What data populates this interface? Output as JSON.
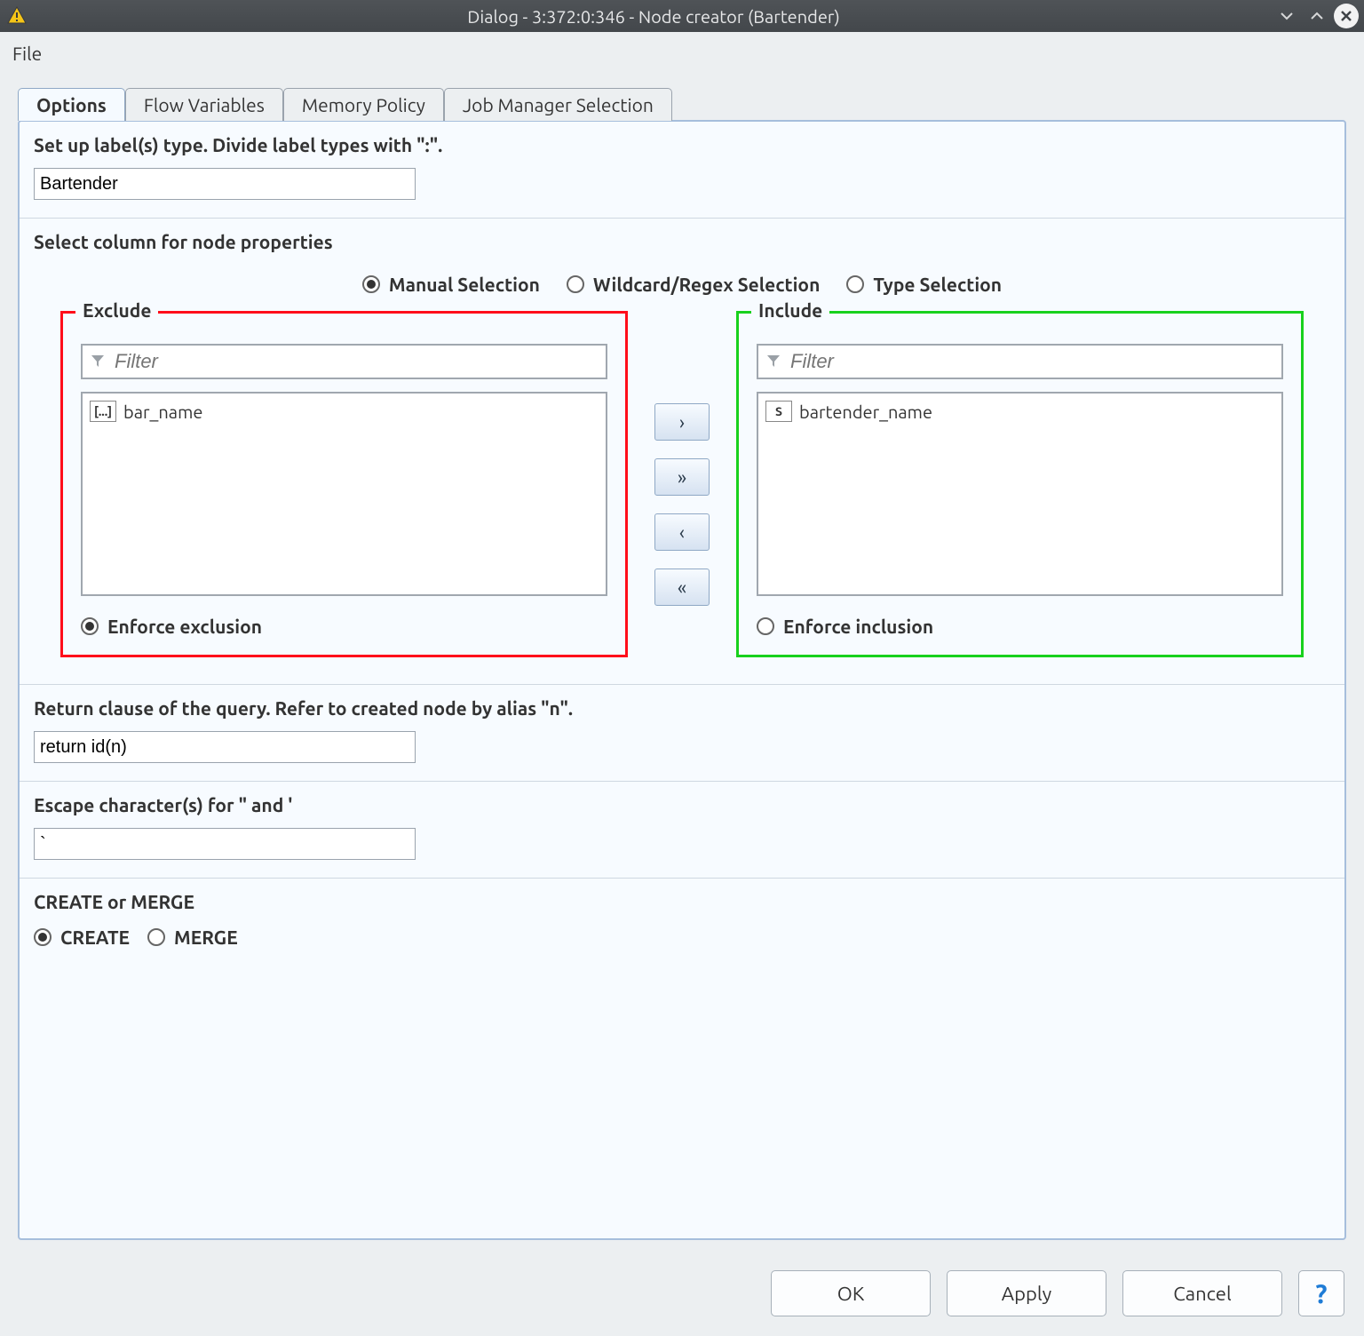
{
  "titlebar": {
    "title": "Dialog - 3:372:0:346 - Node creator (Bartender)"
  },
  "menubar": {
    "file": "File"
  },
  "tabs": [
    {
      "label": "Options",
      "active": true
    },
    {
      "label": "Flow Variables",
      "active": false
    },
    {
      "label": "Memory Policy",
      "active": false
    },
    {
      "label": "Job Manager Selection",
      "active": false
    }
  ],
  "sections": {
    "labels": {
      "title": "Set up label(s) type. Divide label types with \":\".",
      "value": "Bartender"
    },
    "columns": {
      "title": "Select column for node properties",
      "modes": [
        {
          "label": "Manual Selection",
          "selected": true
        },
        {
          "label": "Wildcard/Regex Selection",
          "selected": false
        },
        {
          "label": "Type Selection",
          "selected": false
        }
      ],
      "exclude": {
        "legend": "Exclude",
        "filter_placeholder": "Filter",
        "items": [
          {
            "type_badge": "[...]",
            "name": "bar_name"
          }
        ],
        "enforce_label": "Enforce exclusion",
        "enforce_selected": true
      },
      "include": {
        "legend": "Include",
        "filter_placeholder": "Filter",
        "items": [
          {
            "type_badge": "S",
            "name": "bartender_name"
          }
        ],
        "enforce_label": "Enforce inclusion",
        "enforce_selected": false
      },
      "move_buttons": {
        "add_one": "›",
        "add_all": "»",
        "remove_one": "‹",
        "remove_all": "«"
      }
    },
    "return_clause": {
      "title": "Return clause of the query. Refer to created node by alias \"n\".",
      "value": "return id(n)"
    },
    "escape": {
      "title": "Escape character(s) for \" and '",
      "value": "`"
    },
    "create_merge": {
      "title": "CREATE or MERGE",
      "options": [
        {
          "label": "CREATE",
          "selected": true
        },
        {
          "label": "MERGE",
          "selected": false
        }
      ]
    }
  },
  "footer": {
    "ok": "OK",
    "apply": "Apply",
    "cancel": "Cancel",
    "help": "?"
  }
}
